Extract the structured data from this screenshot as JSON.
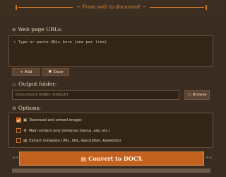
{
  "header": {
    "subtitle": "~ From web to document ~"
  },
  "urls": {
    "label": "Web page URLs:",
    "label_icon": "globe-icon",
    "placeholder": "• Type or paste URLs here (one per line)",
    "add_label": "+ Add",
    "clear_label": "Clear"
  },
  "output": {
    "label": "Output folder:",
    "label_icon": "folder-icon",
    "folder_value": "Documents folder (default)",
    "browse_label": "Browse"
  },
  "options": {
    "label": "Options:",
    "label_icon": "gear-icon",
    "items": [
      {
        "label": "Download and embed images",
        "checked": true,
        "icon": "image-icon"
      },
      {
        "label": "Main content only (removes menus, ads, etc.)",
        "checked": false,
        "icon": "settings-icon"
      },
      {
        "label": "Extract metadata (URL, title, description, keywords)",
        "checked": false,
        "icon": "document-icon"
      }
    ]
  },
  "convert": {
    "label": "Convert to DOCX",
    "icon": "document-icon",
    "left_arrow": ">>",
    "right_arrow": "<<"
  },
  "progress": {
    "value": 0
  },
  "colors": {
    "accent": "#d07022",
    "background": "#3a2c20",
    "panel": "#332418"
  }
}
